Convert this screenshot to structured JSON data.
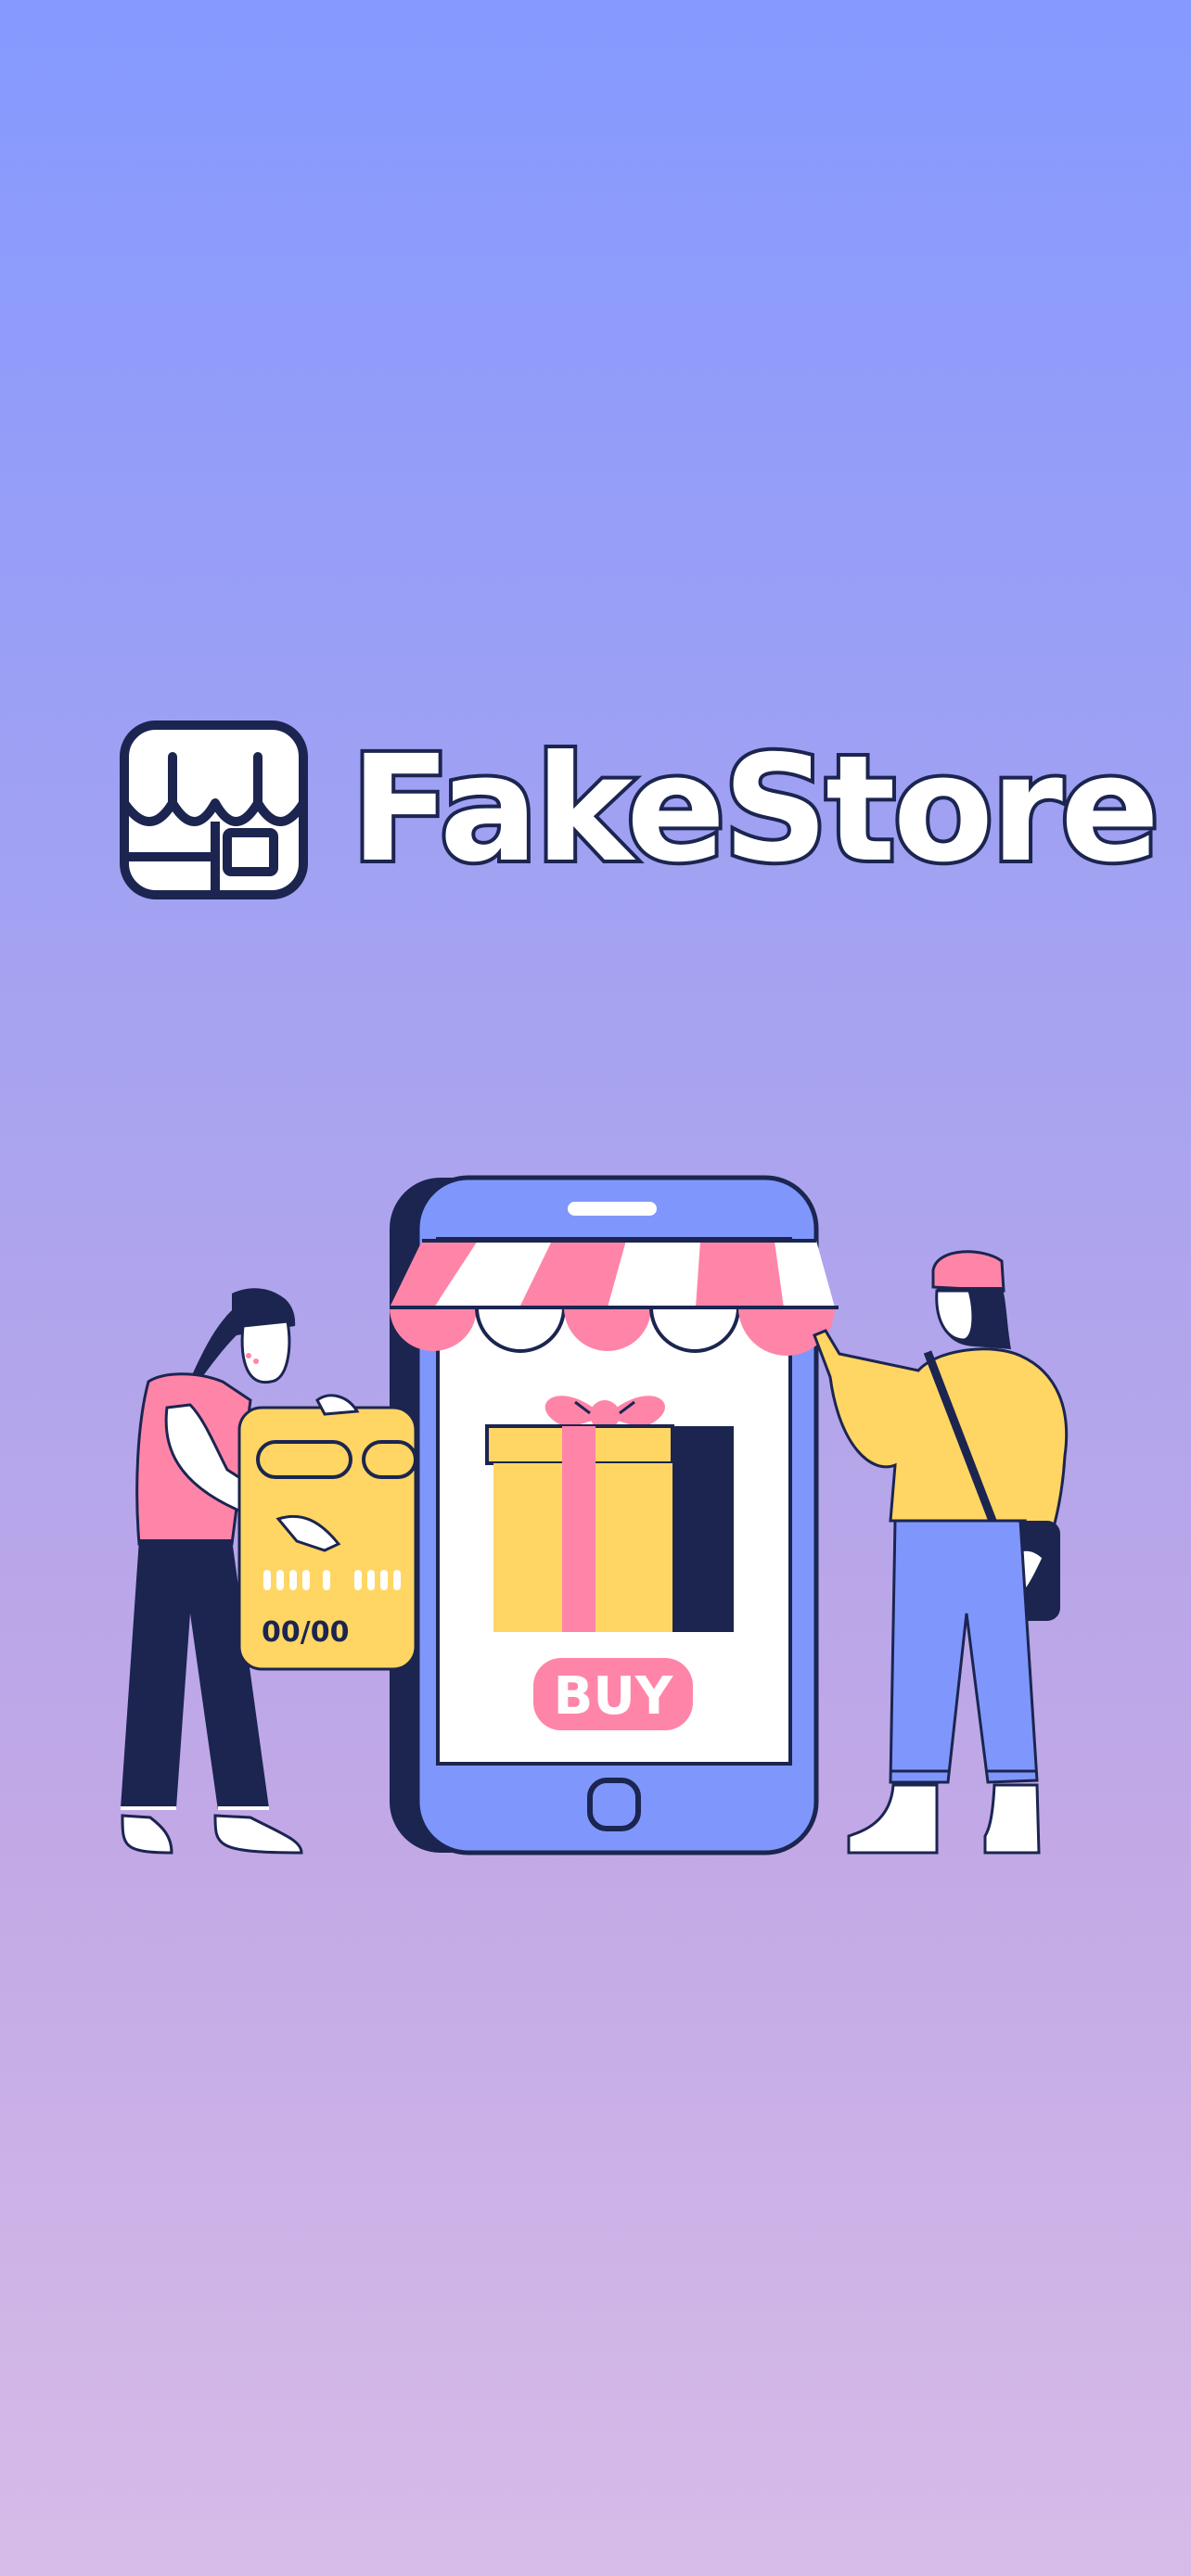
{
  "app": {
    "name": "FakeStore",
    "logo_icon": "storefront-icon"
  },
  "illustration": {
    "phone_button_text": "BUY",
    "card_number_fragment": "00/00",
    "icons": [
      "storefront-awning-icon",
      "gift-box-icon",
      "credit-card-icon",
      "shopping-bag-icon"
    ]
  },
  "colors": {
    "background_top": "#8599ff",
    "background_bottom": "#d7bbe8",
    "navy": "#1b2550",
    "pink": "#ff85a8",
    "yellow": "#ffd563",
    "phone_blue": "#7f97fc",
    "white": "#ffffff"
  }
}
